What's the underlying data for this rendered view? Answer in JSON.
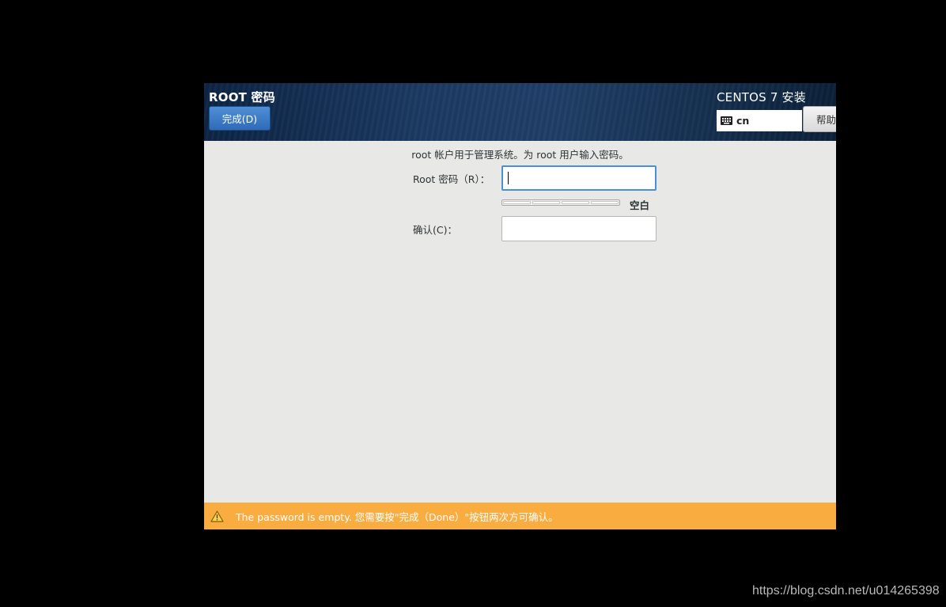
{
  "header": {
    "page_title": "ROOT 密码",
    "done_button_label": "完成(D)",
    "product_title": "CENTOS 7 安装",
    "keyboard_layout": "cn",
    "help_button_label": "帮助"
  },
  "form": {
    "description": "root 帐户用于管理系统。为 root 用户输入密码。",
    "root_password_label": "Root 密码（R）：",
    "root_password_value": "",
    "strength_label": "空白",
    "strength_level": 0,
    "confirm_label": "确认(C)：",
    "confirm_value": ""
  },
  "warning": {
    "icon": "warning-triangle-icon",
    "text": "The password is empty. 您需要按\"完成（Done）\"按钮两次方可确认。"
  },
  "watermark": {
    "text": "https://blog.csdn.net/u014265398"
  },
  "colors": {
    "header_bg": "#1c3a63",
    "done_button": "#3a7bc8",
    "content_bg": "#e8e8e7",
    "warning_bg": "#f9ac40",
    "focus_border": "#4a90d9"
  }
}
